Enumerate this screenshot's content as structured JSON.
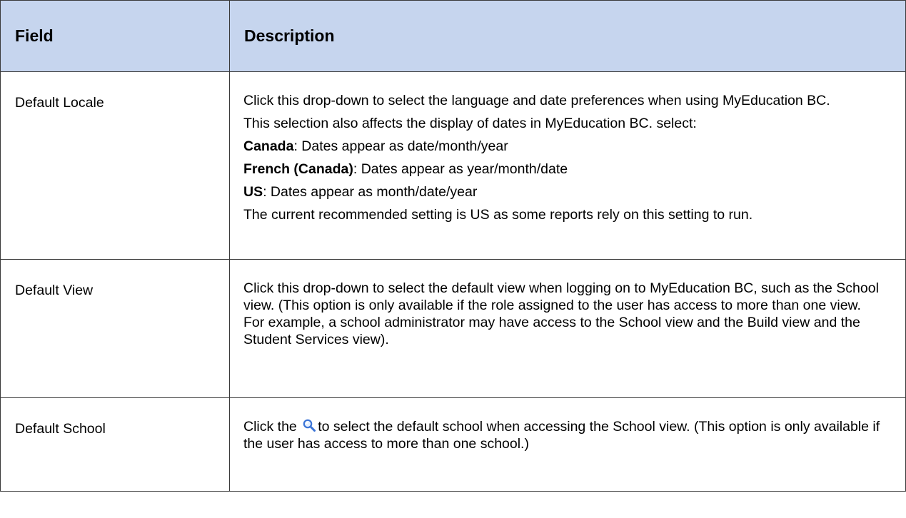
{
  "table": {
    "headers": {
      "field": "Field",
      "description": "Description"
    },
    "rows": [
      {
        "field": "Default Locale",
        "description": {
          "intro": "Click this drop-down to select the language and date preferences when using MyEducation BC.",
          "affects": "This selection also affects the display of dates in MyEducation BC. select:",
          "options": [
            {
              "name": "Canada",
              "text": ": Dates appear as date/month/year"
            },
            {
              "name": "French (Canada)",
              "text": ": Dates appear as year/month/date"
            },
            {
              "name": "US",
              "text": ": Dates appear as month/date/year"
            }
          ],
          "recommendation": "The current recommended setting is US as some reports rely on this setting to run."
        }
      },
      {
        "field": "Default View",
        "description": {
          "text": "Click this drop-down to select the default view when logging on to MyEducation BC, such as the School view. (This option is only available if the role assigned to the user has access to more than one view.  For example, a school administrator may have access to the School view and the Build view and the Student Services view)."
        }
      },
      {
        "field": "Default School",
        "description": {
          "before_icon": "Click the",
          "icon": "magnifier-icon",
          "after_icon": "to select the default school when accessing the School view. (This option is only available if the user has access to more than one school.)"
        }
      }
    ]
  },
  "colors": {
    "header_background": "#c6d5ee",
    "border": "#3a3a3a",
    "icon_blue": "#3b74d6"
  }
}
